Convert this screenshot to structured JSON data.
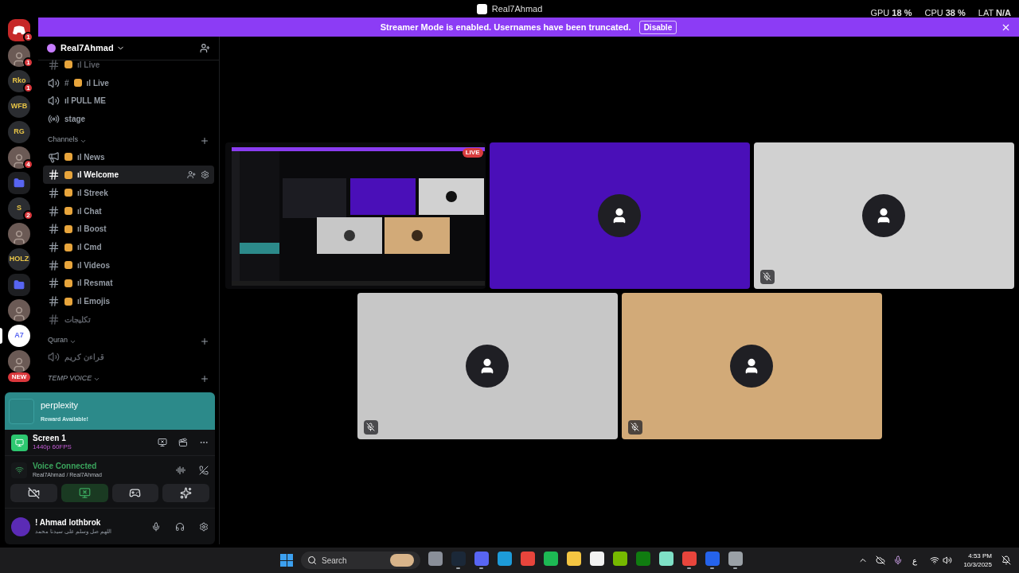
{
  "window": {
    "title": "Real7Ahmad"
  },
  "overlay_stats": [
    {
      "label": "GPU",
      "value": "18 %"
    },
    {
      "label": "CPU",
      "value": "38 %"
    },
    {
      "label": "LAT",
      "value": "N/A"
    }
  ],
  "banner": {
    "text": "Streamer Mode is enabled. Usernames have been truncated.",
    "button": "Disable"
  },
  "servers": [
    {
      "kind": "discord",
      "badge": "1",
      "selected": false
    },
    {
      "kind": "avatar",
      "badge": "1",
      "selected": false
    },
    {
      "kind": "text",
      "label": "Rko",
      "badge": "1",
      "selected": false
    },
    {
      "kind": "text",
      "label": "WFB",
      "selected": false
    },
    {
      "kind": "text",
      "label": "RG",
      "selected": false
    },
    {
      "kind": "avatar",
      "badge": "4",
      "selected": false
    },
    {
      "kind": "folder",
      "selected": false
    },
    {
      "kind": "text",
      "label": "S",
      "badge": "2",
      "selected": false
    },
    {
      "kind": "avatar",
      "selected": false
    },
    {
      "kind": "text",
      "label": "HOLZ",
      "selected": false
    },
    {
      "kind": "folder",
      "selected": false
    },
    {
      "kind": "avatar",
      "selected": false
    },
    {
      "kind": "text",
      "label": "A7",
      "selected": true
    },
    {
      "kind": "avatar",
      "selected": false
    }
  ],
  "new_pill": "NEW",
  "server_name": "Real7Ahmad",
  "channel_groups": [
    {
      "channels": [
        {
          "kind": "text",
          "name": "ıl Live",
          "emoji": true,
          "muted": true,
          "selected": false
        },
        {
          "kind": "voice",
          "prefix": "#",
          "name": "ıl Live",
          "emoji": true,
          "muted": false,
          "selected": false
        },
        {
          "kind": "voice",
          "name": "ıl PULL ME",
          "emoji": false,
          "muted": false,
          "selected": false
        },
        {
          "kind": "stage",
          "name": "stage",
          "emoji": false,
          "muted": false,
          "selected": false
        }
      ]
    },
    {
      "category": "Channels",
      "italic": false,
      "channels": [
        {
          "kind": "announcement",
          "name": "ıl News",
          "emoji": true,
          "muted": false,
          "selected": false
        },
        {
          "kind": "text",
          "name": "ıl Welcome",
          "emoji": true,
          "muted": false,
          "selected": true
        },
        {
          "kind": "text",
          "name": "ıl Streek",
          "emoji": true,
          "muted": false,
          "selected": false
        },
        {
          "kind": "text",
          "name": "ıl Chat",
          "emoji": true,
          "muted": false,
          "selected": false
        },
        {
          "kind": "text",
          "name": "ıl Boost",
          "emoji": true,
          "muted": false,
          "selected": false
        },
        {
          "kind": "text",
          "name": "ıl Cmd",
          "emoji": true,
          "muted": false,
          "selected": false
        },
        {
          "kind": "text",
          "name": "ıl Videos",
          "emoji": true,
          "muted": false,
          "selected": false
        },
        {
          "kind": "text",
          "name": "ıl Resmat",
          "emoji": true,
          "muted": false,
          "selected": false
        },
        {
          "kind": "text",
          "name": "ıl Emojis",
          "emoji": true,
          "muted": false,
          "selected": false
        },
        {
          "kind": "text",
          "name": "تكليجات",
          "emoji": false,
          "muted": true,
          "selected": false
        }
      ]
    },
    {
      "category": "Quran",
      "italic": false,
      "channels": [
        {
          "kind": "voice",
          "name": "قراءن كريم",
          "emoji": false,
          "muted": true,
          "selected": false
        }
      ]
    },
    {
      "category": "TEMP VOICE",
      "italic": true
    }
  ],
  "activity": {
    "title": "perplexity",
    "subtitle": "Reward Available!"
  },
  "stream": {
    "title": "Screen 1",
    "quality": "1440p 60FPS"
  },
  "voice": {
    "status": "Voice Connected",
    "channel": "Real7Ahmad / Real7Ahmad"
  },
  "voice_buttons": [
    {
      "kind": "camera",
      "active": false
    },
    {
      "kind": "screen",
      "active": true
    },
    {
      "kind": "activity",
      "active": false
    },
    {
      "kind": "soundboard",
      "active": false
    }
  ],
  "user": {
    "name": "! Ahmad lothbrok",
    "status": "اللهم صل وسلم على سيدنا محمد"
  },
  "tile_rows": [
    [
      {
        "kind": "stream",
        "badge": "LIVE",
        "mic_off": false
      },
      {
        "kind": "avatar",
        "color": "#4a0fb8",
        "mic_off": false
      },
      {
        "kind": "avatar",
        "color": "#d1d1d1",
        "mic_off": true
      }
    ],
    [
      {
        "kind": "avatar",
        "color": "#c7c7c7",
        "mic_off": true
      },
      {
        "kind": "avatar",
        "color": "#d2aa78",
        "mic_off": true
      }
    ]
  ],
  "taskbar": {
    "search": "Search",
    "apps": [
      {
        "kind": "camera",
        "active": false
      },
      {
        "kind": "steam",
        "active": true
      },
      {
        "kind": "discord",
        "active": true
      },
      {
        "kind": "edge",
        "active": false
      },
      {
        "kind": "chrome",
        "active": false
      },
      {
        "kind": "spotify",
        "active": false
      },
      {
        "kind": "folder",
        "active": false
      },
      {
        "kind": "store",
        "active": false
      },
      {
        "kind": "nvidia",
        "active": false
      },
      {
        "kind": "xbox",
        "active": false
      },
      {
        "kind": "app",
        "active": false
      },
      {
        "kind": "chrome",
        "active": true
      },
      {
        "kind": "remote",
        "active": true
      },
      {
        "kind": "settings",
        "active": true
      }
    ],
    "lang": "ع",
    "time": "4:53 PM",
    "date": "10/3/2025"
  }
}
